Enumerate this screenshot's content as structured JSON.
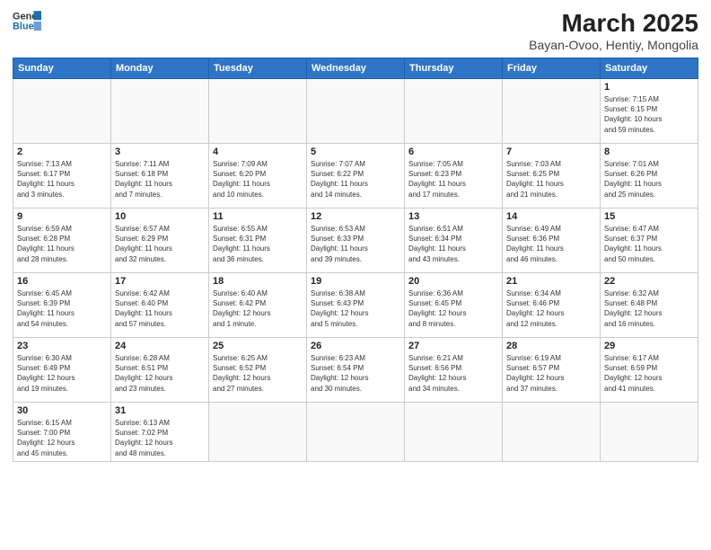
{
  "header": {
    "logo_general": "General",
    "logo_blue": "Blue",
    "title": "March 2025",
    "subtitle": "Bayan-Ovoo, Hentiy, Mongolia"
  },
  "days_of_week": [
    "Sunday",
    "Monday",
    "Tuesday",
    "Wednesday",
    "Thursday",
    "Friday",
    "Saturday"
  ],
  "weeks": [
    [
      {
        "day": "",
        "info": ""
      },
      {
        "day": "",
        "info": ""
      },
      {
        "day": "",
        "info": ""
      },
      {
        "day": "",
        "info": ""
      },
      {
        "day": "",
        "info": ""
      },
      {
        "day": "",
        "info": ""
      },
      {
        "day": "1",
        "info": "Sunrise: 7:15 AM\nSunset: 6:15 PM\nDaylight: 10 hours\nand 59 minutes."
      }
    ],
    [
      {
        "day": "2",
        "info": "Sunrise: 7:13 AM\nSunset: 6:17 PM\nDaylight: 11 hours\nand 3 minutes."
      },
      {
        "day": "3",
        "info": "Sunrise: 7:11 AM\nSunset: 6:18 PM\nDaylight: 11 hours\nand 7 minutes."
      },
      {
        "day": "4",
        "info": "Sunrise: 7:09 AM\nSunset: 6:20 PM\nDaylight: 11 hours\nand 10 minutes."
      },
      {
        "day": "5",
        "info": "Sunrise: 7:07 AM\nSunset: 6:22 PM\nDaylight: 11 hours\nand 14 minutes."
      },
      {
        "day": "6",
        "info": "Sunrise: 7:05 AM\nSunset: 6:23 PM\nDaylight: 11 hours\nand 17 minutes."
      },
      {
        "day": "7",
        "info": "Sunrise: 7:03 AM\nSunset: 6:25 PM\nDaylight: 11 hours\nand 21 minutes."
      },
      {
        "day": "8",
        "info": "Sunrise: 7:01 AM\nSunset: 6:26 PM\nDaylight: 11 hours\nand 25 minutes."
      }
    ],
    [
      {
        "day": "9",
        "info": "Sunrise: 6:59 AM\nSunset: 6:28 PM\nDaylight: 11 hours\nand 28 minutes."
      },
      {
        "day": "10",
        "info": "Sunrise: 6:57 AM\nSunset: 6:29 PM\nDaylight: 11 hours\nand 32 minutes."
      },
      {
        "day": "11",
        "info": "Sunrise: 6:55 AM\nSunset: 6:31 PM\nDaylight: 11 hours\nand 36 minutes."
      },
      {
        "day": "12",
        "info": "Sunrise: 6:53 AM\nSunset: 6:33 PM\nDaylight: 11 hours\nand 39 minutes."
      },
      {
        "day": "13",
        "info": "Sunrise: 6:51 AM\nSunset: 6:34 PM\nDaylight: 11 hours\nand 43 minutes."
      },
      {
        "day": "14",
        "info": "Sunrise: 6:49 AM\nSunset: 6:36 PM\nDaylight: 11 hours\nand 46 minutes."
      },
      {
        "day": "15",
        "info": "Sunrise: 6:47 AM\nSunset: 6:37 PM\nDaylight: 11 hours\nand 50 minutes."
      }
    ],
    [
      {
        "day": "16",
        "info": "Sunrise: 6:45 AM\nSunset: 6:39 PM\nDaylight: 11 hours\nand 54 minutes."
      },
      {
        "day": "17",
        "info": "Sunrise: 6:42 AM\nSunset: 6:40 PM\nDaylight: 11 hours\nand 57 minutes."
      },
      {
        "day": "18",
        "info": "Sunrise: 6:40 AM\nSunset: 6:42 PM\nDaylight: 12 hours\nand 1 minute."
      },
      {
        "day": "19",
        "info": "Sunrise: 6:38 AM\nSunset: 6:43 PM\nDaylight: 12 hours\nand 5 minutes."
      },
      {
        "day": "20",
        "info": "Sunrise: 6:36 AM\nSunset: 6:45 PM\nDaylight: 12 hours\nand 8 minutes."
      },
      {
        "day": "21",
        "info": "Sunrise: 6:34 AM\nSunset: 6:46 PM\nDaylight: 12 hours\nand 12 minutes."
      },
      {
        "day": "22",
        "info": "Sunrise: 6:32 AM\nSunset: 6:48 PM\nDaylight: 12 hours\nand 16 minutes."
      }
    ],
    [
      {
        "day": "23",
        "info": "Sunrise: 6:30 AM\nSunset: 6:49 PM\nDaylight: 12 hours\nand 19 minutes."
      },
      {
        "day": "24",
        "info": "Sunrise: 6:28 AM\nSunset: 6:51 PM\nDaylight: 12 hours\nand 23 minutes."
      },
      {
        "day": "25",
        "info": "Sunrise: 6:25 AM\nSunset: 6:52 PM\nDaylight: 12 hours\nand 27 minutes."
      },
      {
        "day": "26",
        "info": "Sunrise: 6:23 AM\nSunset: 6:54 PM\nDaylight: 12 hours\nand 30 minutes."
      },
      {
        "day": "27",
        "info": "Sunrise: 6:21 AM\nSunset: 6:56 PM\nDaylight: 12 hours\nand 34 minutes."
      },
      {
        "day": "28",
        "info": "Sunrise: 6:19 AM\nSunset: 6:57 PM\nDaylight: 12 hours\nand 37 minutes."
      },
      {
        "day": "29",
        "info": "Sunrise: 6:17 AM\nSunset: 6:59 PM\nDaylight: 12 hours\nand 41 minutes."
      }
    ],
    [
      {
        "day": "30",
        "info": "Sunrise: 6:15 AM\nSunset: 7:00 PM\nDaylight: 12 hours\nand 45 minutes."
      },
      {
        "day": "31",
        "info": "Sunrise: 6:13 AM\nSunset: 7:02 PM\nDaylight: 12 hours\nand 48 minutes."
      },
      {
        "day": "",
        "info": ""
      },
      {
        "day": "",
        "info": ""
      },
      {
        "day": "",
        "info": ""
      },
      {
        "day": "",
        "info": ""
      },
      {
        "day": "",
        "info": ""
      }
    ]
  ]
}
